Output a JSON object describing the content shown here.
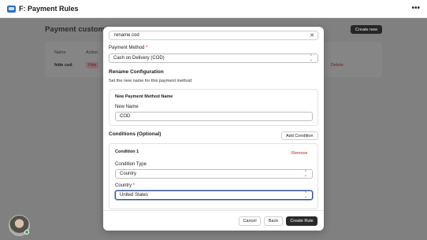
{
  "app": {
    "title": "F: Payment Rules",
    "more_icon": "more-horizontal-icon"
  },
  "background": {
    "heading": "Payment customi",
    "create_button": "Create new",
    "columns": {
      "name": "Name",
      "action": "Action"
    },
    "row": {
      "name": "hide cod",
      "action": "Hide",
      "delete": "Delete"
    }
  },
  "modal": {
    "rule_name_value": "rename cod",
    "payment_method": {
      "label": "Payment Method",
      "required_mark": "*",
      "value": "Cash on Delivery (COD)"
    },
    "rename_section": {
      "title": "Rename Configuration",
      "description": "Set the new name for this payment method:",
      "card_title": "New Payment Method Name",
      "field_label": "New Name",
      "field_value": "COD"
    },
    "conditions": {
      "title": "Conditions (Optional)",
      "add_button": "Add Condition",
      "items": [
        {
          "title": "Condition 1",
          "remove": "Remove",
          "type_label": "Condition Type",
          "type_value": "Country",
          "country_label": "Country",
          "country_required": "*",
          "country_value": "United States"
        }
      ]
    },
    "footer": {
      "cancel": "Cancel",
      "back": "Back",
      "create": "Create Rule"
    }
  },
  "colors": {
    "primary_button": "#2a2a2a",
    "danger_text": "#b3261e",
    "focus_ring": "#2c4a8c",
    "status_online": "#2fae4f"
  }
}
